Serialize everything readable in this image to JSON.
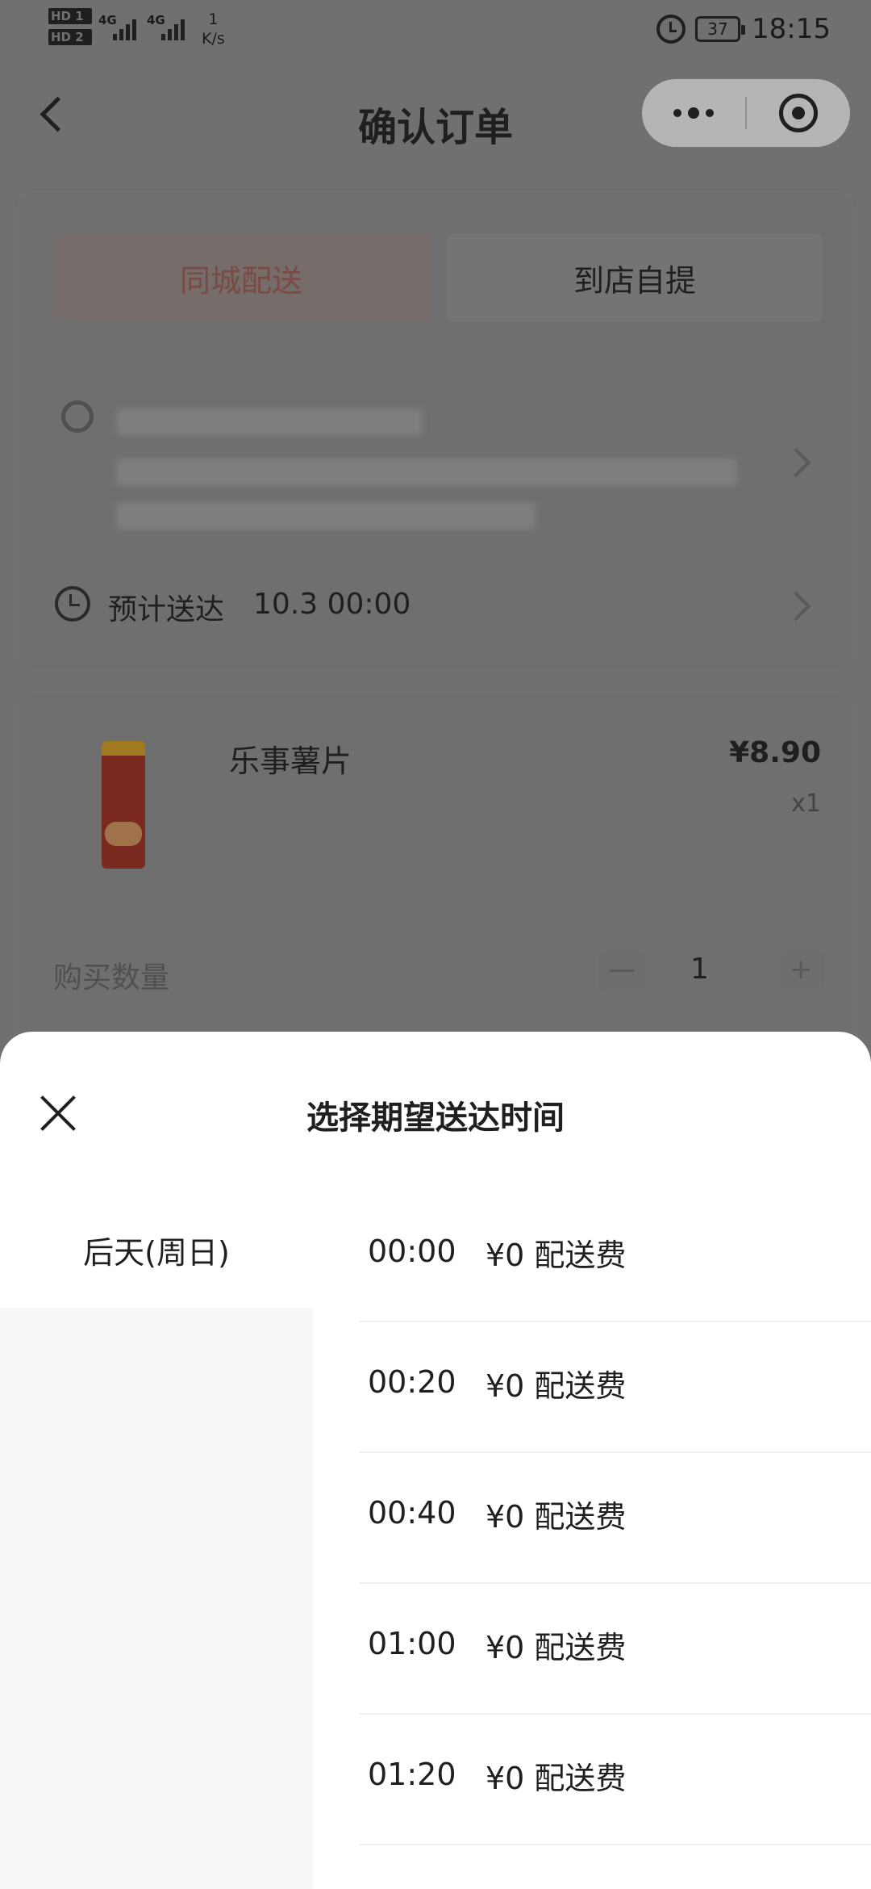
{
  "status_bar": {
    "hd1": "HD 1",
    "hd2": "HD 2",
    "net1": "4G",
    "net2": "4G",
    "speed_value": "1",
    "speed_unit": "K/s",
    "battery": "37",
    "time": "18:15"
  },
  "header": {
    "title": "确认订单"
  },
  "delivery": {
    "tabs": [
      {
        "label": "同城配送",
        "active": true
      },
      {
        "label": "到店自提",
        "active": false
      }
    ],
    "eta_label": "预计送达",
    "eta_time": "10.3 00:00"
  },
  "product": {
    "name": "乐事薯片",
    "price": "¥8.90",
    "quantity": "x1",
    "quantity_label": "购买数量",
    "stepper_value": "1",
    "stepper_plus": "+"
  },
  "sheet": {
    "title": "选择期望送达时间",
    "days": [
      {
        "label": "后天(周日)",
        "selected": true
      }
    ],
    "slots": [
      {
        "time": "00:00",
        "fee": "¥0 配送费"
      },
      {
        "time": "00:20",
        "fee": "¥0 配送费"
      },
      {
        "time": "00:40",
        "fee": "¥0 配送费"
      },
      {
        "time": "01:00",
        "fee": "¥0 配送费"
      },
      {
        "time": "01:20",
        "fee": "¥0 配送费"
      }
    ]
  },
  "colors": {
    "overlay": "#707070",
    "accent": "#e0523f",
    "sheet_bg": "#ffffff",
    "day_col_bg": "#f6f6f6"
  },
  "icons": [
    "back-arrow-icon",
    "more-dots-icon",
    "target-circle-icon",
    "location-pin-icon",
    "chevron-right-icon",
    "clock-icon",
    "close-icon"
  ]
}
